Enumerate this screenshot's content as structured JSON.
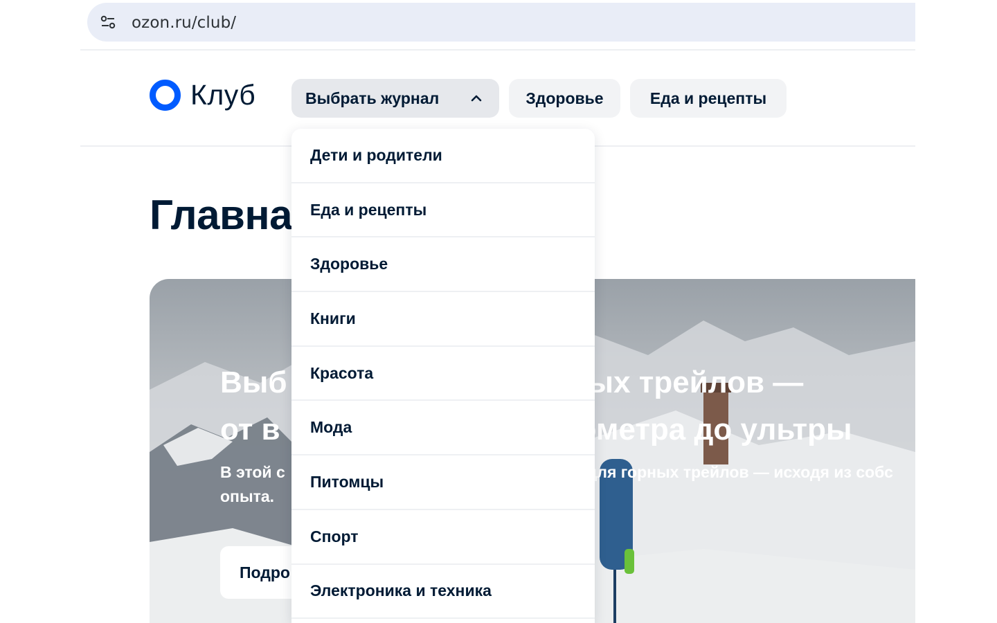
{
  "browser": {
    "url": "ozon.ru/club/",
    "settings_icon": "tune-icon"
  },
  "header": {
    "logo_text": "Клуб",
    "brand_color": "#005bff",
    "nav": {
      "journal_label": "Выбрать журнал",
      "health_label": "Здоровье",
      "food_label": "Еда и рецепты"
    }
  },
  "main": {
    "title": "Главная",
    "hero": {
      "title_left_1": "Выб",
      "title_right_1": "ых трейлов —",
      "title_left_2": "от в",
      "title_right_2": "ометра до ультры",
      "subtitle_left_1": "В этой с",
      "subtitle_right_1": "для горных трейлов — исходя из собс",
      "subtitle_left_2": "опыта.",
      "button_label": "Подро"
    }
  },
  "dropdown": {
    "items": [
      "Дети и родители",
      "Еда и рецепты",
      "Здоровье",
      "Книги",
      "Красота",
      "Мода",
      "Питомцы",
      "Спорт",
      "Электроника и техника"
    ]
  }
}
